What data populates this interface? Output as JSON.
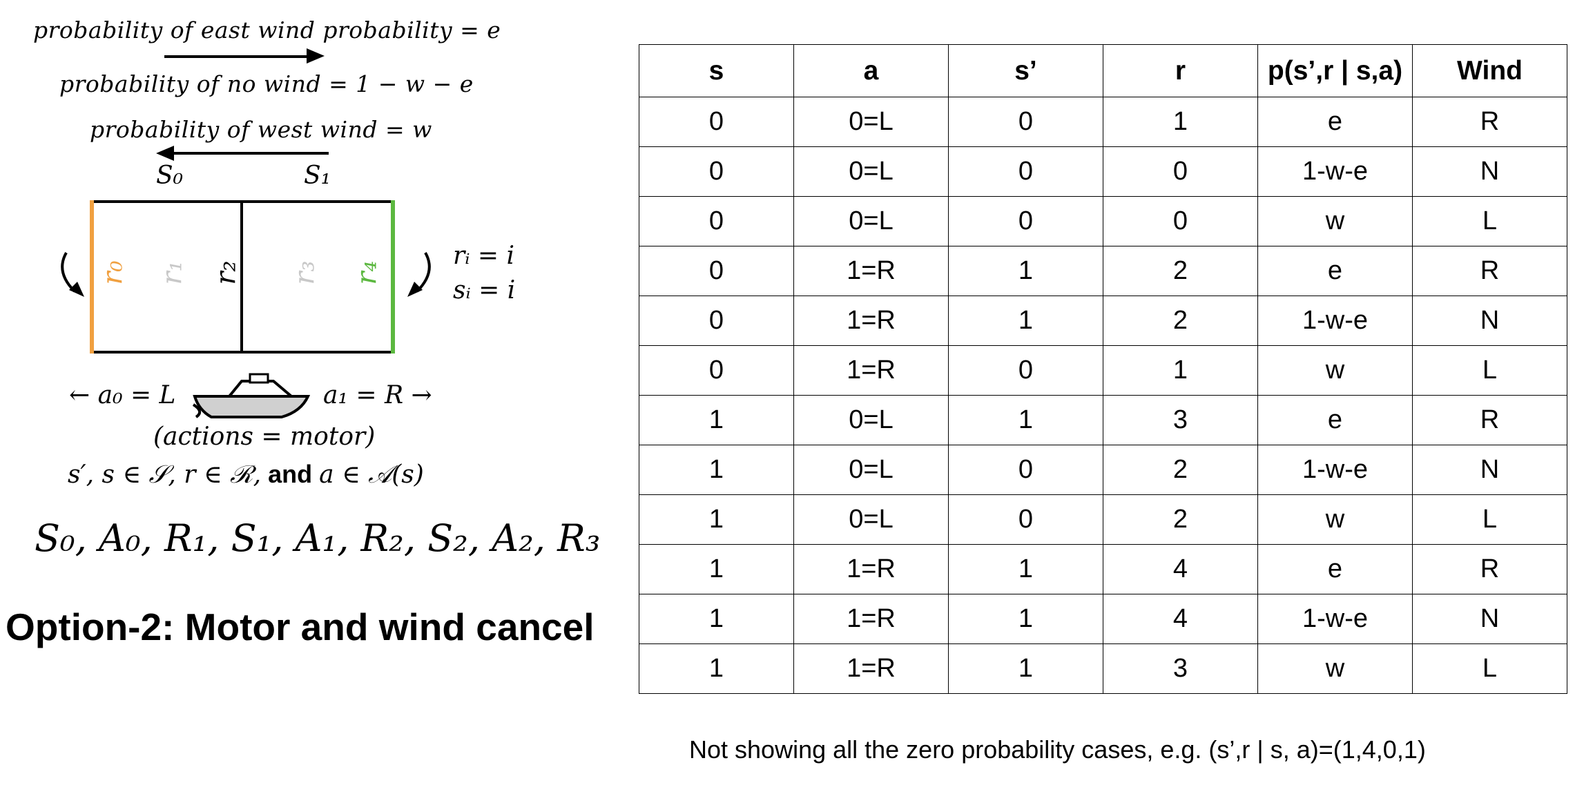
{
  "diagram": {
    "east_wind_eq": "probability of east wind probability = e",
    "no_wind_eq": "probability of no wind = 1 − w − e",
    "west_wind_eq": "probability of west wind = w",
    "state_s0": "S₀",
    "state_s1": "S₁",
    "rewards": [
      "r₀",
      "r₁",
      "r₂",
      "r₃",
      "r₄"
    ],
    "reward_colors": [
      "#f0a040",
      "#c8c8c8",
      "#000000",
      "#c8c8c8",
      "#5cb840"
    ],
    "left_wall_color": "#f0a040",
    "right_wall_color": "#5cb840",
    "ri_eq": "rᵢ = i",
    "si_eq": "sᵢ = i",
    "action_left": "← a₀ = L",
    "action_right": "a₁ = R →",
    "actions_caption": "(actions = motor)",
    "sets_math": "s′, s ∈ 𝒮, r ∈ ℛ,",
    "sets_and": "and",
    "sets_action": "a ∈ 𝒜(s)",
    "boat_icon": "motorboat-icon",
    "sequence": "S₀, A₀, R₁, S₁, A₁, R₂, S₂, A₂, R₃"
  },
  "title": "Option-2: Motor and wind cancel",
  "table": {
    "headers": [
      "s",
      "a",
      "s’",
      "r",
      "p(s’,r | s,a)",
      "Wind"
    ],
    "rows": [
      [
        "0",
        "0=L",
        "0",
        "1",
        "e",
        "R"
      ],
      [
        "0",
        "0=L",
        "0",
        "0",
        "1-w-e",
        "N"
      ],
      [
        "0",
        "0=L",
        "0",
        "0",
        "w",
        "L"
      ],
      [
        "0",
        "1=R",
        "1",
        "2",
        "e",
        "R"
      ],
      [
        "0",
        "1=R",
        "1",
        "2",
        "1-w-e",
        "N"
      ],
      [
        "0",
        "1=R",
        "0",
        "1",
        "w",
        "L"
      ],
      [
        "1",
        "0=L",
        "1",
        "3",
        "e",
        "R"
      ],
      [
        "1",
        "0=L",
        "0",
        "2",
        "1-w-e",
        "N"
      ],
      [
        "1",
        "0=L",
        "0",
        "2",
        "w",
        "L"
      ],
      [
        "1",
        "1=R",
        "1",
        "4",
        "e",
        "R"
      ],
      [
        "1",
        "1=R",
        "1",
        "4",
        "1-w-e",
        "N"
      ],
      [
        "1",
        "1=R",
        "1",
        "3",
        "w",
        "L"
      ]
    ]
  },
  "note": "Not showing all the zero probability cases, e.g. (s’,r | s, a)=(1,4,0,1)"
}
